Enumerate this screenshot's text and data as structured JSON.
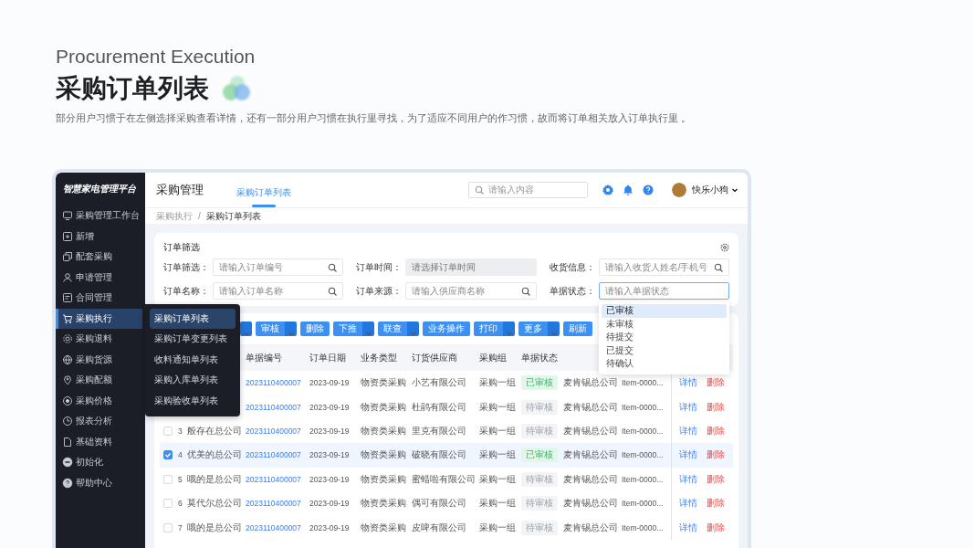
{
  "slide": {
    "subtitle": "Procurement Execution",
    "title": "采购订单列表",
    "description": "部分用户习惯于在左侧选择采购查看详情，还有一部分用户习惯在执行里寻找，为了适应不同用户的作习惯，故而将订单相关放入订单执行里 。"
  },
  "app": {
    "brand": "智慧家电管理平台",
    "sidebar": {
      "items": [
        {
          "label": "采购管理工作台",
          "selected": false
        },
        {
          "label": "新增",
          "selected": false
        },
        {
          "label": "配套采购",
          "selected": false
        },
        {
          "label": "申请管理",
          "selected": false
        },
        {
          "label": "合同管理",
          "selected": false
        },
        {
          "label": "采购执行",
          "selected": true,
          "flyout": [
            {
              "label": "采购订单列表",
              "selected": true
            },
            {
              "label": "采购订单变更列表",
              "selected": false
            },
            {
              "label": "收料通知单列表",
              "selected": false
            },
            {
              "label": "采购入库单列表",
              "selected": false
            },
            {
              "label": "采购验收单列表",
              "selected": false
            }
          ]
        },
        {
          "label": "采购退料",
          "selected": false
        },
        {
          "label": "采购货源",
          "selected": false
        },
        {
          "label": "采购配额",
          "selected": false
        },
        {
          "label": "采购价格",
          "selected": false
        },
        {
          "label": "报表分析",
          "selected": false
        },
        {
          "label": "基础资料",
          "selected": false
        },
        {
          "label": "初始化",
          "selected": false
        },
        {
          "label": "帮助中心",
          "selected": false
        }
      ]
    },
    "header": {
      "title": "采购管理",
      "tabs": [
        {
          "label": "采购订单列表",
          "selected": true
        }
      ],
      "search": {
        "placeholder": "请输入内容"
      },
      "user": {
        "name": "快乐小狗"
      }
    },
    "breadcrumb": {
      "items": [
        "采购执行",
        "采购订单列表"
      ],
      "separator": "/"
    },
    "filter": {
      "title": "订单筛选",
      "fields": [
        {
          "label": "订单筛选：",
          "placeholder": "请输入订单编号",
          "kind": "search"
        },
        {
          "label": "订单时间：",
          "placeholder": "请选择订单时间",
          "kind": "date"
        },
        {
          "label": "收货信息：",
          "placeholder": "请输入收货人姓名/手机号",
          "kind": "search"
        },
        {
          "label": "订单名称：",
          "placeholder": "请输入订单名称",
          "kind": "search"
        },
        {
          "label": "订单来源：",
          "placeholder": "请输入供应商名称",
          "kind": "search"
        },
        {
          "label": "单据状态：",
          "placeholder": "请输入单据状态",
          "kind": "select",
          "expanded": true,
          "options": [
            {
              "label": "已审核",
              "selected": true
            },
            {
              "label": "未审核",
              "selected": false
            },
            {
              "label": "待提交",
              "selected": false
            },
            {
              "label": "已提交",
              "selected": false
            },
            {
              "label": "待确认",
              "selected": false
            }
          ]
        }
      ]
    },
    "toolbar": {
      "buttons": [
        {
          "kind": "caret"
        },
        {
          "kind": "split",
          "label": "审核"
        },
        {
          "kind": "plain",
          "label": "删除"
        },
        {
          "kind": "split",
          "label": "下推"
        },
        {
          "kind": "split",
          "label": "联查"
        },
        {
          "kind": "plain",
          "label": "业务操作"
        },
        {
          "kind": "split",
          "label": "打印"
        },
        {
          "kind": "split",
          "label": "更多"
        },
        {
          "kind": "plain",
          "label": "刷新"
        }
      ]
    },
    "table": {
      "columns": [
        "单据编号",
        "订单日期",
        "业务类型",
        "订货供应商",
        "采购组",
        "单据状态"
      ],
      "rows": [
        {
          "code": "2023110400007",
          "date": "2023-09-19",
          "type": "物资类采购",
          "supplier": "小艺有限公司",
          "group": "采购一组",
          "status": "已审核",
          "color": "#e3f6ea",
          "customer": "麦肯锡总公司",
          "item": "Item-0000...",
          "actions": [
            {
              "label": "详情",
              "kind": "view"
            },
            {
              "label": "删除",
              "kind": "delete"
            }
          ]
        },
        {
          "code": "2023110400007",
          "date": "2023-09-19",
          "type": "物资类采购",
          "supplier": "杜鹃有限公司",
          "group": "采购一组",
          "status": "待审核",
          "color": "#f2f4f7",
          "customer": "麦肯锡总公司",
          "item": "Item-0000...",
          "actions": [
            {
              "label": "详情",
              "kind": "view"
            },
            {
              "label": "删除",
              "kind": "delete"
            }
          ]
        },
        {
          "checked": false,
          "number": "3",
          "company": "般存在总公司",
          "code": "2023110400007",
          "date": "2023-09-19",
          "type": "物资类采购",
          "supplier": "里克有限公司",
          "group": "采购一组",
          "status": "待审核",
          "color": "#f2f4f7",
          "customer": "麦肯锡总公司",
          "item": "Item-0000...",
          "actions": [
            {
              "label": "详情",
              "kind": "view"
            },
            {
              "label": "删除",
              "kind": "delete"
            }
          ]
        },
        {
          "checked": true,
          "number": "4",
          "company": "优美的总公司",
          "code": "2023110400007",
          "date": "2023-09-19",
          "type": "物资类采购",
          "supplier": "破晓有限公司",
          "group": "采购一组",
          "status": "已审核",
          "color": "#e3f6ea",
          "customer": "麦肯锡总公司",
          "item": "Item-0000...",
          "actions": [
            {
              "label": "详情",
              "kind": "view"
            },
            {
              "label": "删除",
              "kind": "delete"
            }
          ]
        },
        {
          "checked": false,
          "number": "5",
          "company": "哦的是总公司",
          "code": "2023110400007",
          "date": "2023-09-19",
          "type": "物资类采购",
          "supplier": "蜜蜡啦有限公司",
          "group": "采购一组",
          "status": "待审核",
          "color": "#f2f4f7",
          "customer": "麦肯锡总公司",
          "item": "Item-0000...",
          "actions": [
            {
              "label": "详情",
              "kind": "view"
            },
            {
              "label": "删除",
              "kind": "delete"
            }
          ]
        },
        {
          "checked": false,
          "number": "6",
          "company": "莫代尔总公司",
          "code": "2023110400007",
          "date": "2023-09-19",
          "type": "物资类采购",
          "supplier": "偶可有限公司",
          "group": "采购一组",
          "status": "待审核",
          "color": "#f2f4f7",
          "customer": "麦肯锡总公司",
          "item": "Item-0000...",
          "actions": [
            {
              "label": "详情",
              "kind": "view"
            },
            {
              "label": "删除",
              "kind": "delete"
            }
          ]
        },
        {
          "checked": false,
          "number": "7",
          "company": "哦的是总公司",
          "code": "2023110400007",
          "date": "2023-09-19",
          "type": "物资类采购",
          "supplier": "皮啤有限公司",
          "group": "采购一组",
          "status": "待审核",
          "color": "#f2f4f7",
          "customer": "麦肯锡总公司",
          "item": "Item-0000...",
          "actions": [
            {
              "label": "详情",
              "kind": "view"
            },
            {
              "label": "删除",
              "kind": "delete"
            }
          ]
        }
      ]
    }
  }
}
